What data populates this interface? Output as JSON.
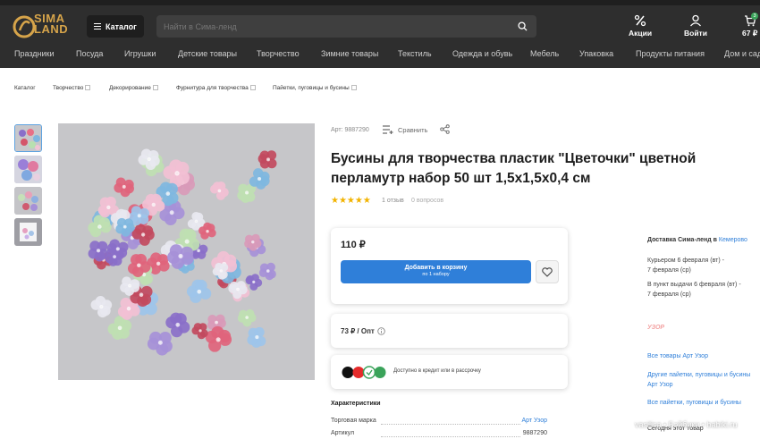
{
  "header": {
    "logo_line1": "SIMA",
    "logo_line2": "LAND",
    "catalog_label": "Каталог",
    "search_placeholder": "Найти в Сима-ленд",
    "actions": [
      {
        "icon": "percent-icon",
        "label": "Акции"
      },
      {
        "icon": "user-icon",
        "label": "Войти"
      },
      {
        "icon": "cart-icon",
        "label": "67 ₽",
        "badge": "3"
      }
    ]
  },
  "nav": [
    "Праздники",
    "Посуда",
    "Игрушки",
    "Детские товары",
    "Творчество",
    "Зимние товары",
    "Текстиль",
    "Одежда и обувь",
    "Мебель",
    "Упаковка",
    "Продукты питания",
    "Дом и сад"
  ],
  "breadcrumbs": [
    "Каталог",
    "Творчество",
    "Декорирование",
    "Фурнитура для творчества",
    "Пайетки, пуговицы и бусины"
  ],
  "product": {
    "article": "Арт: 9887290",
    "compare_label": "Сравнить",
    "title": "Бусины для творчества пластик \"Цветочки\" цветной перламутр набор 50 шт 1,5х1,5х0,4 см",
    "stars": "★★★★★",
    "rating": 5,
    "reviews": "1 отзыв",
    "questions": "0 вопросов",
    "price": "110 ₽",
    "cart_label": "Добавить в корзину",
    "cart_sublabel": "по 1 набору",
    "opt_price": "73 ₽ / Опт",
    "credit_text": "Доступно в кредит или в рассрочку",
    "characteristics_title": "Характеристики",
    "characteristics": [
      {
        "name": "Торговая марка",
        "value": "Арт Узор"
      },
      {
        "name": "Артикул",
        "value": "9887290"
      }
    ]
  },
  "delivery": {
    "title": "Доставка Сима-ленд в",
    "city": "Кемерово",
    "courier": "Курьером 6 февраля (вт) -",
    "courier2": "7 февраля (ср)",
    "pickup": "В пункт выдачи 6 февраля (вт) -",
    "pickup2": "7 февраля (ср)"
  },
  "seller": {
    "logo": "УЗОР",
    "links": [
      "Все товары Арт Узор",
      "Другие пайетки, пуговицы и бусины",
      "Арт Узор",
      "Все пайетки, пуговицы и бусины"
    ],
    "bottom": "Сегодня этот товар"
  },
  "watermark": "vasilisa • Бэйбики • babiki.ru",
  "colors": {
    "accent": "#2f7fd9",
    "header_bg": "#2e2e2e",
    "star": "#f2b300",
    "logo_gold": "#d6a44a"
  }
}
